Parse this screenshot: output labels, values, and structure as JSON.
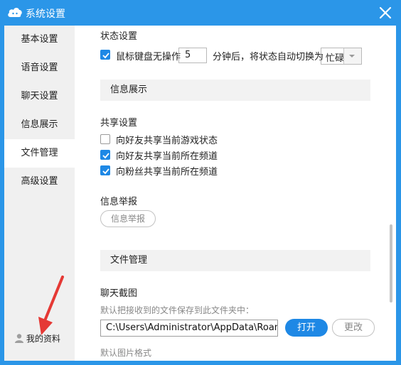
{
  "window": {
    "title": "系统设置"
  },
  "sidebar": {
    "items": [
      {
        "label": "基本设置"
      },
      {
        "label": "语音设置"
      },
      {
        "label": "聊天设置"
      },
      {
        "label": "信息展示"
      },
      {
        "label": "文件管理"
      },
      {
        "label": "高级设置"
      }
    ],
    "active_index": 4,
    "profile_label": "我的资料"
  },
  "status_settings": {
    "heading": "状态设置",
    "checkbox_checked": true,
    "label_before": "鼠标键盘无操作",
    "minutes_value": "5",
    "label_after": "分钟后，将状态自动切换为",
    "status_value": "忙碌"
  },
  "info_display": {
    "section_title": "信息展示",
    "share": {
      "heading": "共享设置",
      "options": [
        {
          "label": "向好友共享当前游戏状态",
          "checked": false
        },
        {
          "label": "向好友共享当前所在频道",
          "checked": true
        },
        {
          "label": "向粉丝共享当前所在频道",
          "checked": true
        }
      ]
    },
    "report": {
      "heading": "信息举报",
      "button_label": "信息举报"
    }
  },
  "file_management": {
    "section_title": "文件管理",
    "chat_screenshot": {
      "heading": "聊天截图",
      "description": "默认把接收到的文件保存到此文件夹中：",
      "path_value": "C:\\Users\\Administrator\\AppData\\Roaming",
      "open_button": "打开",
      "change_button": "更改"
    },
    "image_format_heading": "默认图片格式"
  },
  "colors": {
    "accent": "#1e88e5",
    "titlebar": "#2b96e8",
    "sidebar_bg": "#f0f0f0",
    "section_bg": "#f2f2f2",
    "annotation_arrow": "#e53935"
  }
}
